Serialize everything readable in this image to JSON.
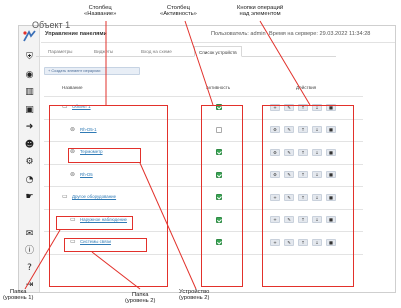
{
  "annotations": {
    "name_col": [
      "Столбец",
      "«Название»"
    ],
    "active_col": [
      "Столбец",
      "«Активность»"
    ],
    "op_buttons": [
      "Кнопки операций",
      "над элементом"
    ],
    "folder1": [
      "Папка",
      "(уровень 1)"
    ],
    "folder2": [
      "Папка",
      "(уровень 2)"
    ],
    "device2": [
      "Устройство",
      "(уровень 2)"
    ]
  },
  "topbar": {
    "title": "Управление панелями",
    "user": "Пользователь: admin",
    "server_time": "Время на сервере: 29.03.2022 11:34:28"
  },
  "object_title": "Объект 1",
  "tabs": [
    "Параметры",
    "Виджеты",
    "Вход на схеме",
    "Список устройств"
  ],
  "create_button": "+ Создать элемент иерархии",
  "table": {
    "headers": {
      "name": "Название",
      "active": "Активность",
      "actions": "Действия"
    },
    "rows": [
      {
        "name": "Объект 1",
        "icon": "folder-icon",
        "active": true,
        "level": 1
      },
      {
        "name": "Rh-D5-1",
        "icon": "device-icon",
        "active": false,
        "level": 2
      },
      {
        "name": "Термометр",
        "icon": "device-icon",
        "active": true,
        "level": 2
      },
      {
        "name": "Rh-D5",
        "icon": "device-icon",
        "active": true,
        "level": 2
      },
      {
        "name": "Другое оборудование",
        "icon": "folder-icon",
        "active": true,
        "level": 1
      },
      {
        "name": "Наружное наблюдение",
        "icon": "folder-icon",
        "active": true,
        "level": 2
      },
      {
        "name": "Системы связи",
        "icon": "folder-icon",
        "active": true,
        "level": 2
      }
    ],
    "action_glyphs": [
      "+",
      "✎",
      "↑",
      "↓",
      "■"
    ],
    "action_glyphs_device": [
      "⚙",
      "✎",
      "↑",
      "↓",
      "■"
    ]
  },
  "sidebar_icons": [
    "shield-icon",
    "eye-icon",
    "chart-icon",
    "calendar-icon",
    "login-icon",
    "users-icon",
    "gear-icon",
    "speedometer-icon",
    "hand-icon",
    "mail-icon",
    "info-icon",
    "help-icon",
    "logout-icon"
  ],
  "colors": {
    "annotation_red": "#e2312b",
    "check_green": "#3aa655",
    "link_blue": "#2f7ab5"
  }
}
